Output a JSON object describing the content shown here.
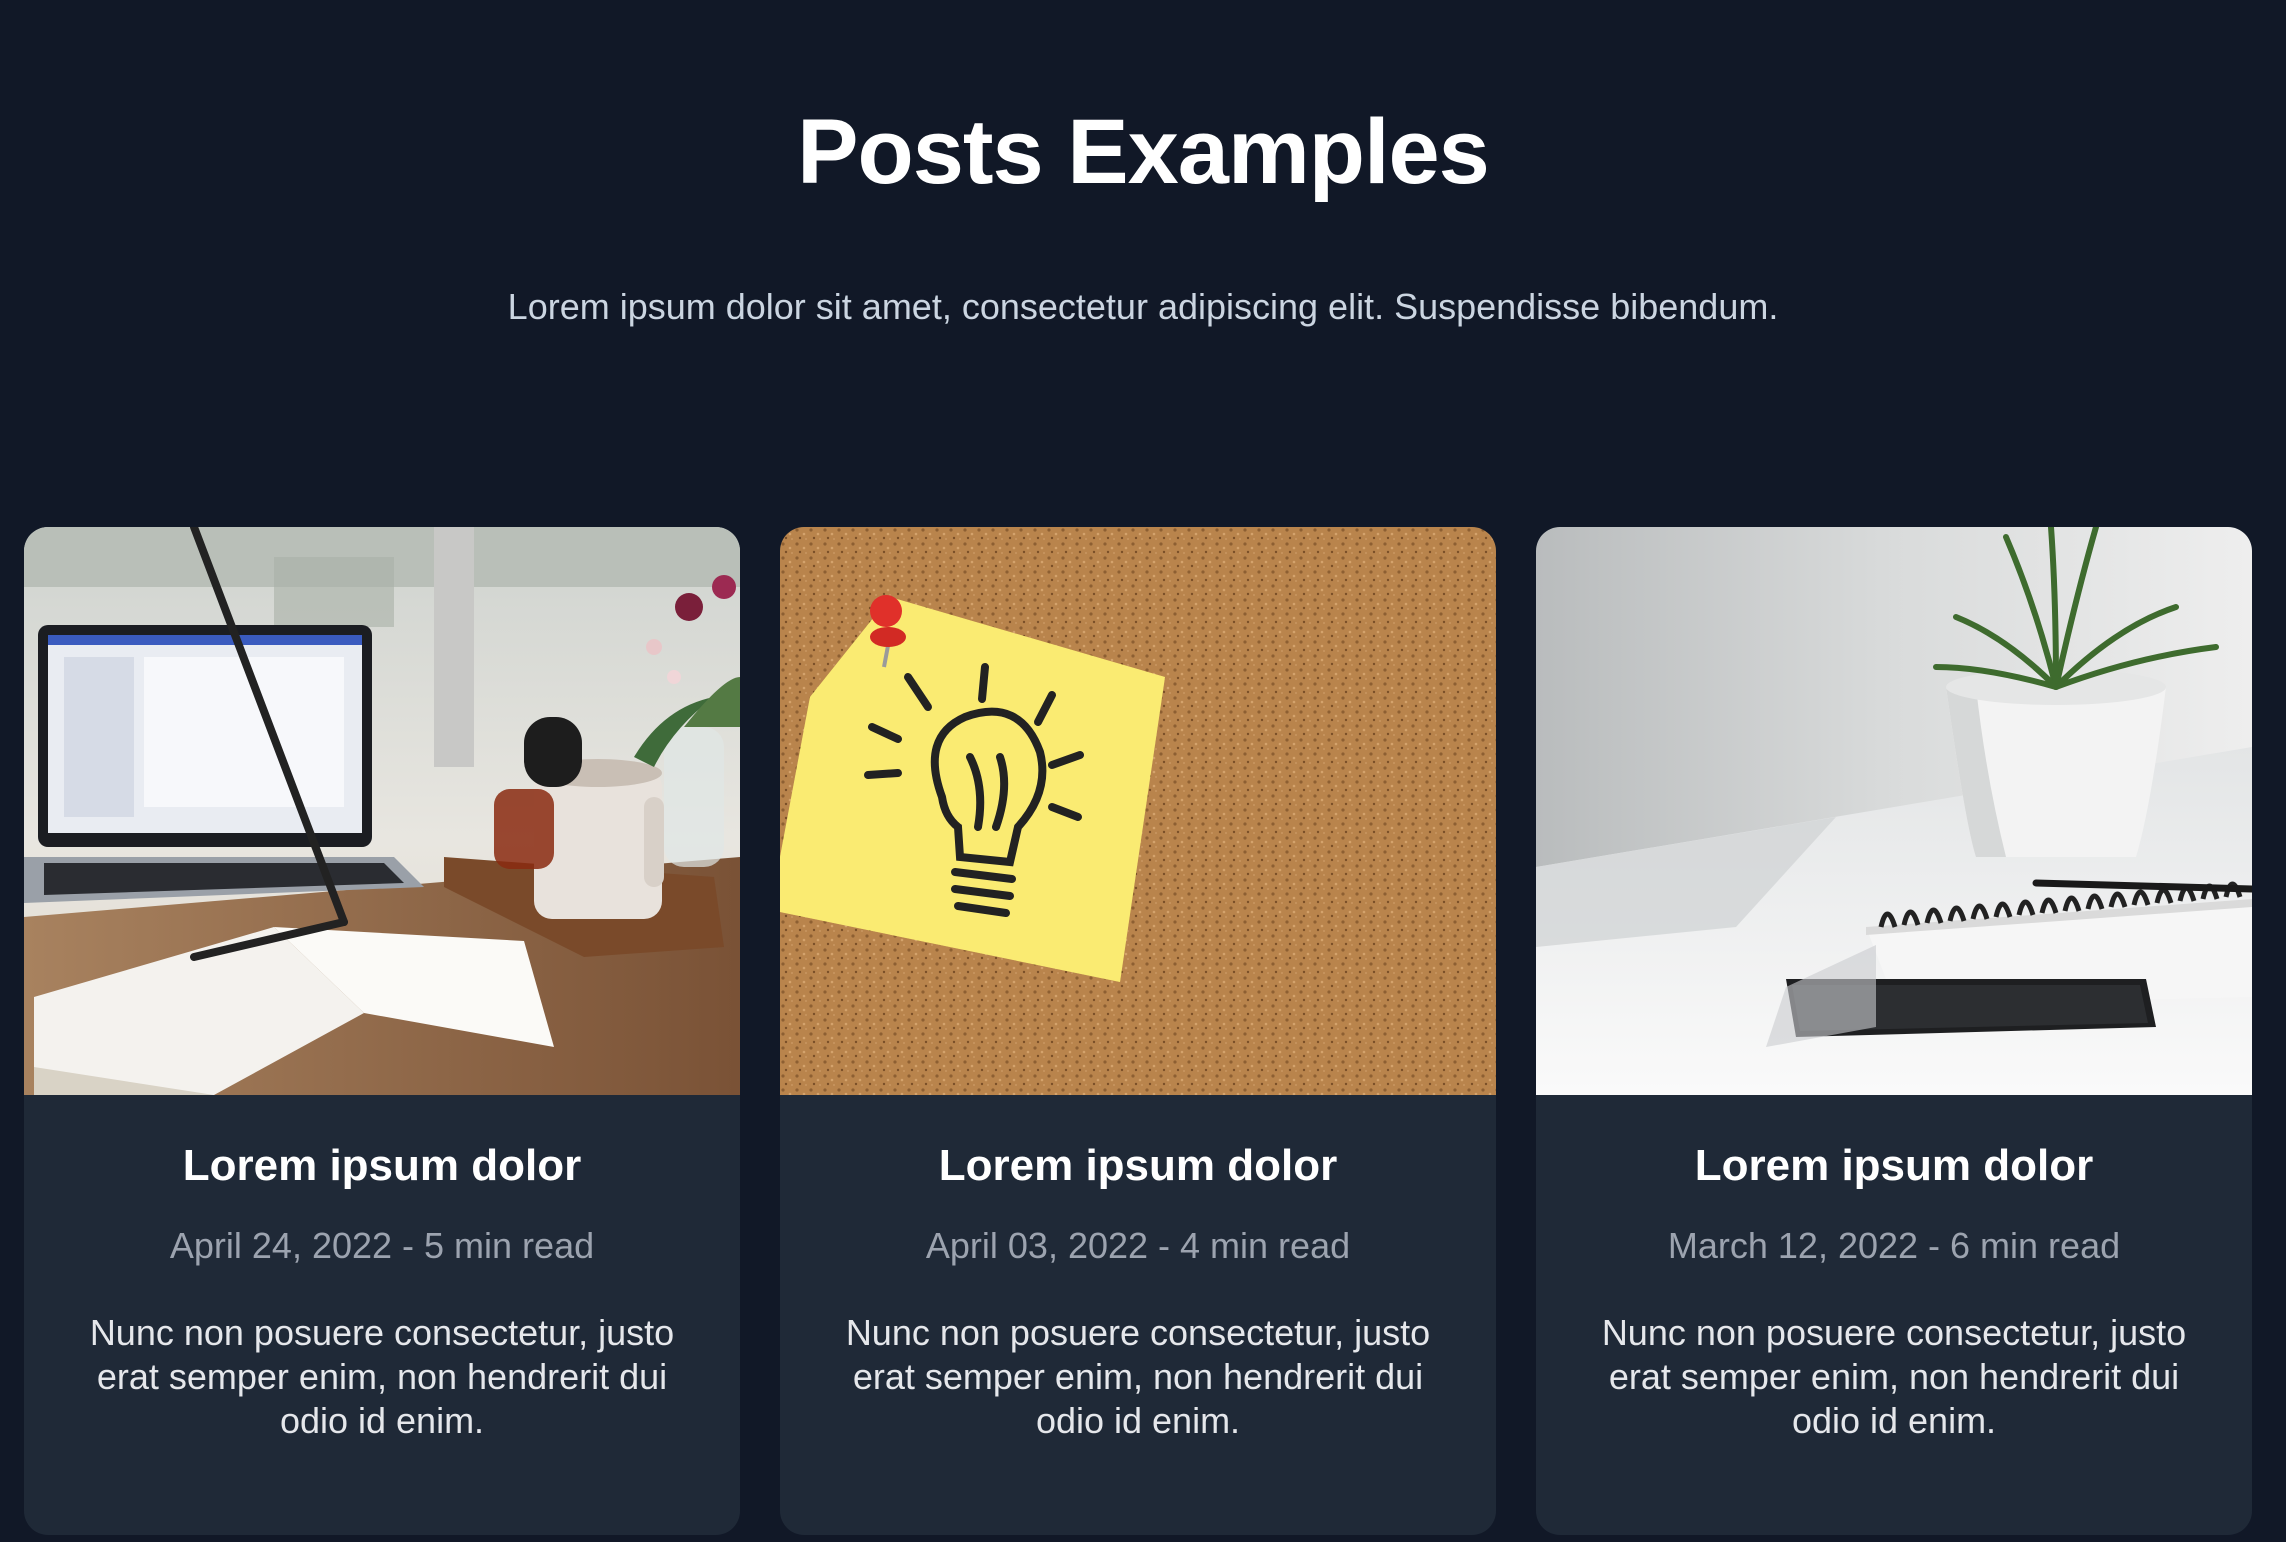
{
  "header": {
    "title": "Posts Examples",
    "subtitle": "Lorem ipsum dolor sit amet, consectetur adipiscing elit. Suspendisse bibendum."
  },
  "colors": {
    "background": "#111827",
    "card_background": "#1f2937",
    "title_text": "#ffffff",
    "meta_text": "#9ca3af",
    "body_text": "#e5e7eb"
  },
  "posts": [
    {
      "image": "desk-with-laptop-notebook-and-mug-photo",
      "title": "Lorem ipsum dolor",
      "meta": "April 24, 2022 - 5 min read",
      "excerpt": "Nunc non posuere consectetur, justo erat semper enim, non hendrerit dui odio id enim."
    },
    {
      "image": "lightbulb-sticky-note-on-corkboard-photo",
      "title": "Lorem ipsum dolor",
      "meta": "April 03, 2022 - 4 min read",
      "excerpt": "Nunc non posuere consectetur, justo erat semper enim, non hendrerit dui odio id enim."
    },
    {
      "image": "white-desk-with-plant-notebook-and-phone-photo",
      "title": "Lorem ipsum dolor",
      "meta": "March 12, 2022 - 6 min read",
      "excerpt": "Nunc non posuere consectetur, justo erat semper enim, non hendrerit dui odio id enim."
    }
  ]
}
